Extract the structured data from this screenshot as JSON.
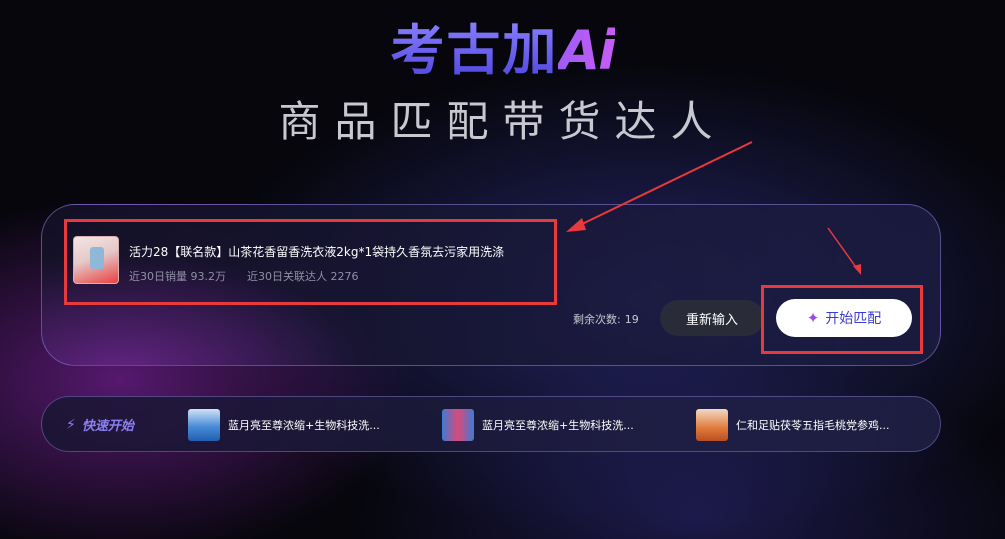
{
  "header": {
    "logo_cn": "考古加",
    "logo_ai": "Ai",
    "subtitle": "商品匹配带货达人"
  },
  "product": {
    "title": "活力28【联名款】山茶花香留香洗衣液2kg*1袋持久香氛去污家用洗涤",
    "sales_30d": "近30日销量 93.2万",
    "talents_30d": "近30日关联达人 2276"
  },
  "actions": {
    "remaining_label": "剩余次数:",
    "remaining_count": "19",
    "reinput_label": "重新输入",
    "match_label": "开始匹配",
    "match_icon": "sparkle-icon"
  },
  "quick_start": {
    "label": "快速开始",
    "icon": "bolt-icon",
    "items": [
      {
        "text": "蓝月亮至尊浓缩+生物科技洗..."
      },
      {
        "text": "蓝月亮至尊浓缩+生物科技洗..."
      },
      {
        "text": "仁和足贴茯苓五指毛桃党参鸡..."
      }
    ]
  },
  "colors": {
    "accent": "#6a5cf0",
    "highlight_red": "#e8393c",
    "button_text": "#3b3bd6"
  }
}
